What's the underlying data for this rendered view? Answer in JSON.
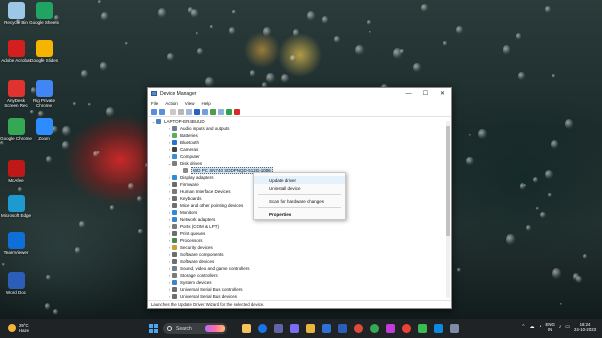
{
  "desktop": {
    "icons": [
      {
        "label": "Recycle Bin",
        "icon": "recycle-bin-icon",
        "color": "#9cc7e6"
      },
      {
        "label": "Google Sheets",
        "icon": "sheets-icon",
        "color": "#1fa463"
      },
      {
        "label": "Adobe Acrobat",
        "icon": "acrobat-icon",
        "color": "#d3201e"
      },
      {
        "label": "Google Slides",
        "icon": "slides-icon",
        "color": "#f4b400"
      },
      {
        "label": "AnyDesk Screen Rec",
        "icon": "anydesk-icon",
        "color": "#e0322e"
      },
      {
        "label": "Rig Private Chrome",
        "icon": "chrome-icon-1",
        "color": "#4285f4"
      },
      {
        "label": "Google Chrome",
        "icon": "chrome-icon-2",
        "color": "#34a853"
      },
      {
        "label": "Zoom",
        "icon": "zoom-icon",
        "color": "#2d8cff"
      },
      {
        "label": "McAfee",
        "icon": "mcafee-icon",
        "color": "#c01818"
      },
      {
        "label": "Microsoft Edge",
        "icon": "edge-icon",
        "color": "#1d9bd1"
      },
      {
        "label": "TeamViewer",
        "icon": "teamviewer-icon",
        "color": "#0e6fd6"
      },
      {
        "label": "Word Doc",
        "icon": "document-icon",
        "color": "#2b5eb8"
      }
    ]
  },
  "window": {
    "title": "Device Manager",
    "controls": {
      "minimize": "—",
      "maximize": "☐",
      "close": "✕"
    },
    "menu": [
      "File",
      "Action",
      "View",
      "Help"
    ],
    "tree": [
      {
        "label": "LAPTOP-ER4BUUD",
        "level": "root",
        "color": "#4f7fbf",
        "expander": "⌄"
      },
      {
        "label": "Audio inputs and outputs",
        "level": "child",
        "color": "#6d7e8c",
        "expander": "›"
      },
      {
        "label": "Batteries",
        "level": "child",
        "color": "#5bb15b",
        "expander": "›"
      },
      {
        "label": "Bluetooth",
        "level": "child",
        "color": "#2a72d2",
        "expander": "›"
      },
      {
        "label": "Cameras",
        "level": "child",
        "color": "#444444",
        "expander": "›"
      },
      {
        "label": "Computer",
        "level": "child",
        "color": "#3a8ed6",
        "expander": "›"
      },
      {
        "label": "Disk drives",
        "level": "child",
        "color": "#7d7d7d",
        "expander": "⌄"
      },
      {
        "label": "WD PC SN740 SDDPNQD-512G-1006",
        "level": "sub",
        "color": "#8a8a8a",
        "expander": "",
        "selected": true
      },
      {
        "label": "Display adapters",
        "level": "child",
        "color": "#2f8ad8",
        "expander": "›"
      },
      {
        "label": "Firmware",
        "level": "child",
        "color": "#6b6b6b",
        "expander": "›"
      },
      {
        "label": "Human Interface Devices",
        "level": "child",
        "color": "#7a7a7a",
        "expander": "›"
      },
      {
        "label": "Keyboards",
        "level": "child",
        "color": "#6e6e6e",
        "expander": "›"
      },
      {
        "label": "Mice and other pointing devices",
        "level": "child",
        "color": "#6e6e6e",
        "expander": "›"
      },
      {
        "label": "Monitors",
        "level": "child",
        "color": "#2f8ad8",
        "expander": "›"
      },
      {
        "label": "Network adapters",
        "level": "child",
        "color": "#3a86c9",
        "expander": "›"
      },
      {
        "label": "Ports (COM & LPT)",
        "level": "child",
        "color": "#7a7a7a",
        "expander": "›"
      },
      {
        "label": "Print queues",
        "level": "child",
        "color": "#6e6e6e",
        "expander": "›"
      },
      {
        "label": "Processors",
        "level": "child",
        "color": "#4c8a4c",
        "expander": "›"
      },
      {
        "label": "Security devices",
        "level": "child",
        "color": "#c7a23a",
        "expander": "›"
      },
      {
        "label": "Software components",
        "level": "child",
        "color": "#6e6e6e",
        "expander": "›"
      },
      {
        "label": "Software devices",
        "level": "child",
        "color": "#6e6e6e",
        "expander": "›"
      },
      {
        "label": "Sound, video and game controllers",
        "level": "child",
        "color": "#6d7e8c",
        "expander": "›"
      },
      {
        "label": "Storage controllers",
        "level": "child",
        "color": "#7a7a7a",
        "expander": "›"
      },
      {
        "label": "System devices",
        "level": "child",
        "color": "#3a86c9",
        "expander": "›"
      },
      {
        "label": "Universal Serial Bus controllers",
        "level": "child",
        "color": "#6e6e6e",
        "expander": "›"
      },
      {
        "label": "Universal Serial Bus devices",
        "level": "child",
        "color": "#6e6e6e",
        "expander": "›"
      }
    ],
    "status": "Launches the Update Driver Wizard for the selected device."
  },
  "context_menu": {
    "items": [
      "Update driver",
      "Uninstall device",
      "Scan for hardware changes",
      "Properties"
    ]
  },
  "taskbar": {
    "weather_temp": "29°C",
    "weather_desc": "Haze",
    "search_label": "Search",
    "lang_top": "ENG",
    "lang_bottom": "IN",
    "time": "18:24",
    "date": "24-10-2023"
  }
}
